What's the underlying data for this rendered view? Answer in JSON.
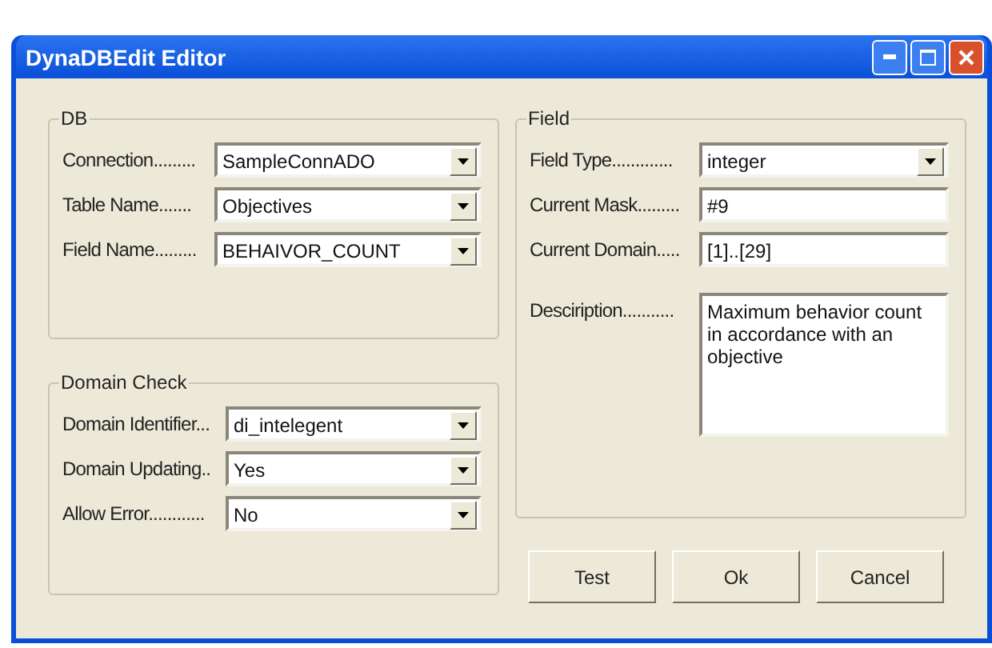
{
  "window": {
    "title": "DynaDBEdit Editor"
  },
  "groups": [
    {
      "title": "DB",
      "rows": [
        {
          "label": "Connection.........",
          "kind": "combo",
          "value": "SampleConnADO"
        },
        {
          "label": "Table Name.......",
          "kind": "combo",
          "value": "Objectives"
        },
        {
          "label": "Field Name.........",
          "kind": "combo",
          "value": "BEHAIVOR_COUNT"
        }
      ]
    },
    {
      "title": "Domain Check",
      "rows": [
        {
          "label": "Domain Identifier...",
          "kind": "combo",
          "value": "di_intelegent"
        },
        {
          "label": "Domain Updating..",
          "kind": "combo",
          "value": "Yes"
        },
        {
          "label": "Allow Error............",
          "kind": "combo",
          "value": "No"
        }
      ]
    },
    {
      "title": "Field",
      "rows": [
        {
          "label": "Field Type.............",
          "kind": "combo",
          "value": "integer"
        },
        {
          "label": "Current Mask.........",
          "kind": "text",
          "value": "#9"
        },
        {
          "label": "Current Domain.....",
          "kind": "text",
          "value": "[1]..[29]"
        },
        {
          "label": "Desciription...........",
          "kind": "memo",
          "value": "Maximum behavior count in accordance with an objective"
        }
      ]
    }
  ],
  "buttons": [
    "Test",
    "Ok",
    "Cancel"
  ]
}
